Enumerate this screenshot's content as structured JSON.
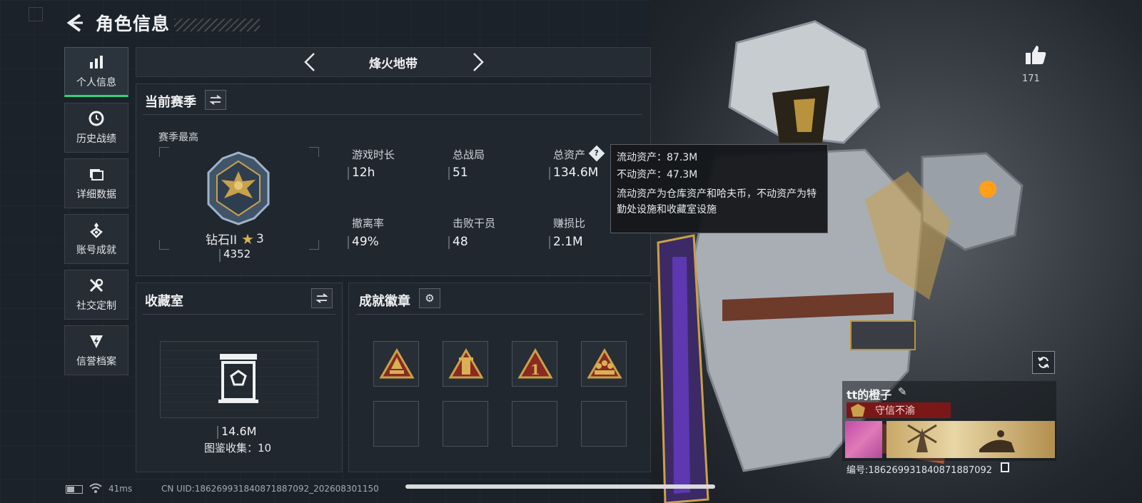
{
  "header": {
    "title": "角色信息"
  },
  "sidebar": {
    "items": [
      {
        "label": "个人信息",
        "icon": "bar-chart-icon",
        "active": true
      },
      {
        "label": "历史战绩",
        "icon": "clock-icon"
      },
      {
        "label": "详细数据",
        "icon": "folder-icon"
      },
      {
        "label": "账号成就",
        "icon": "medal-icon"
      },
      {
        "label": "社交定制",
        "icon": "tools-icon"
      },
      {
        "label": "信誉档案",
        "icon": "shield-bolt-icon"
      }
    ]
  },
  "season_selector": {
    "name": "烽火地带"
  },
  "current_season": {
    "title": "当前赛季",
    "season_best_label": "赛季最高",
    "rank_name": "钻石II",
    "rank_stars": "3",
    "rank_score": "4352",
    "stats": [
      {
        "label": "游戏时长",
        "value": "12h"
      },
      {
        "label": "总战局",
        "value": "51"
      },
      {
        "label": "总资产",
        "value": "134.6M"
      },
      {
        "label": "撤离率",
        "value": "49%"
      },
      {
        "label": "击败干员",
        "value": "48"
      },
      {
        "label": "赚损比",
        "value": "2.1M"
      }
    ]
  },
  "tooltip": {
    "liquid": "流动资产：87.3M",
    "fixed": "不动资产：47.3M",
    "desc": "流动资产为仓库资产和哈夫币，不动资产为特勤处设施和收藏室设施"
  },
  "collection": {
    "title": "收藏室",
    "value": "14.6M",
    "catalog_label": "图鉴收集：",
    "catalog_count": "10"
  },
  "achievements": {
    "title": "成就徽章",
    "badges": [
      "warning-triangle-badge",
      "tower-badge",
      "number-one-badge",
      "squad-badge"
    ],
    "empty_slots": 4
  },
  "profile_card": {
    "likes": "171",
    "player_name": "tt的橙子",
    "title": "守信不渝",
    "id_label": "编号:186269931840871887092"
  },
  "footer": {
    "ping": "41ms",
    "uid": "CN UID:186269931840871887092_202608301150"
  },
  "colors": {
    "accent_green": "#2fd27a",
    "title_red": "#7a1818",
    "gold": "#c9a14a"
  }
}
